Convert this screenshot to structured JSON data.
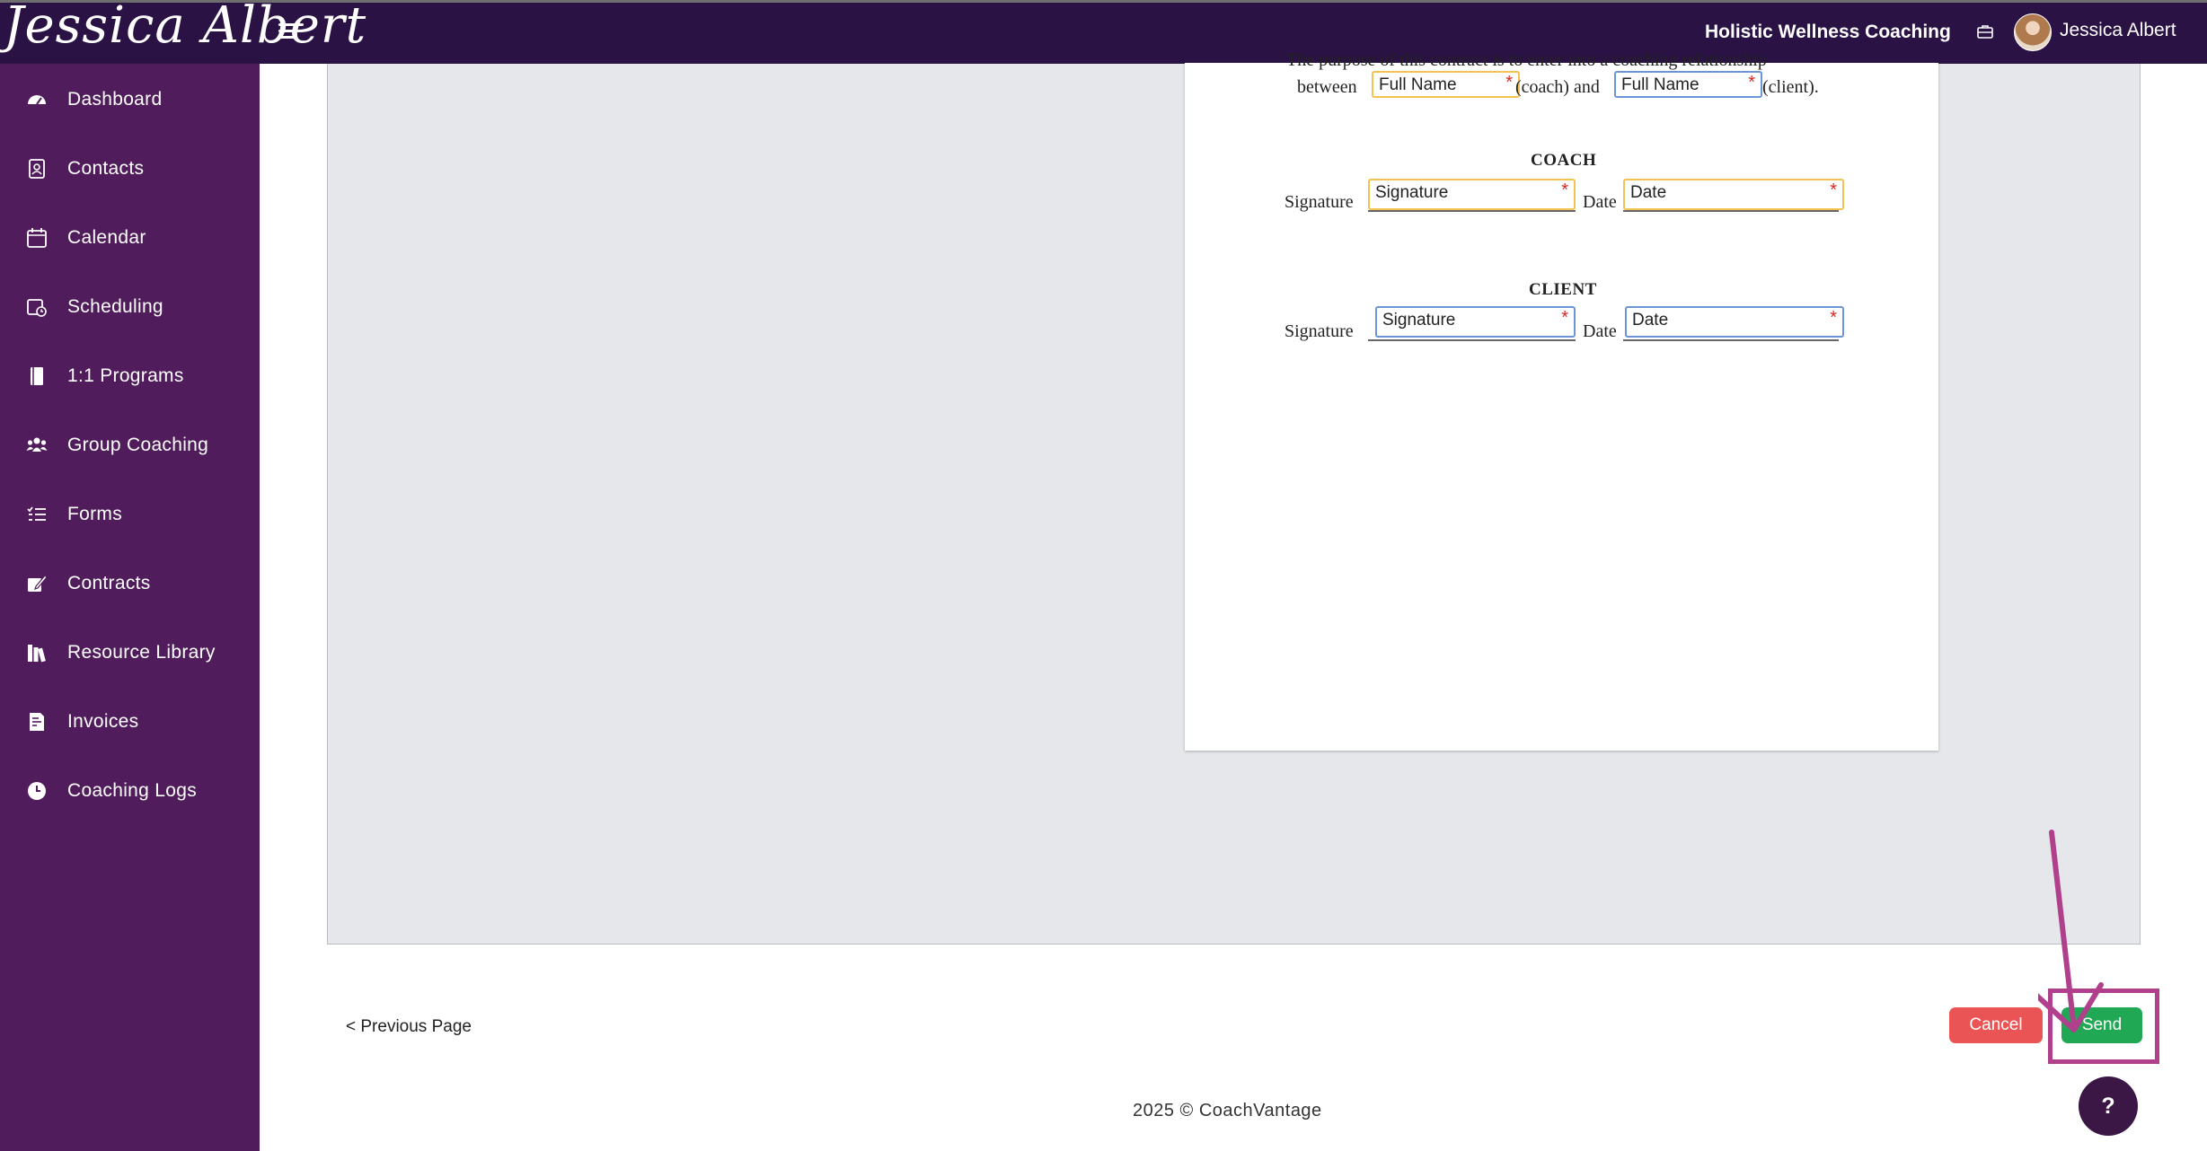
{
  "header": {
    "logo_text": "Jessica Albert",
    "business_name": "Holistic Wellness Coaching",
    "user_name": "Jessica Albert"
  },
  "sidebar": {
    "items": [
      {
        "label": "Dashboard",
        "icon": "dashboard-icon"
      },
      {
        "label": "Contacts",
        "icon": "contacts-icon"
      },
      {
        "label": "Calendar",
        "icon": "calendar-icon"
      },
      {
        "label": "Scheduling",
        "icon": "scheduling-icon"
      },
      {
        "label": "1:1 Programs",
        "icon": "book-icon"
      },
      {
        "label": "Group Coaching",
        "icon": "group-icon"
      },
      {
        "label": "Forms",
        "icon": "checklist-icon"
      },
      {
        "label": "Contracts",
        "icon": "edit-icon"
      },
      {
        "label": "Resource Library",
        "icon": "library-icon"
      },
      {
        "label": "Invoices",
        "icon": "invoice-icon"
      },
      {
        "label": "Coaching Logs",
        "icon": "clock-icon"
      }
    ]
  },
  "document": {
    "cut_text": "The purpose of this contract is to enter into a coaching relationship",
    "between_text": "between",
    "coach_suffix": "(coach) and",
    "client_suffix": "(client).",
    "full_name_placeholder": "Full Name",
    "required_mark": "*",
    "coach_heading": "COACH",
    "client_heading": "CLIENT",
    "signature_label": "Signature",
    "date_label": "Date",
    "signature_field": "Signature",
    "date_field": "Date"
  },
  "actions": {
    "previous_page": "< Previous Page",
    "cancel": "Cancel",
    "send": "Send",
    "help": "?"
  },
  "footer": {
    "text": "2025 © CoachVantage"
  },
  "colors": {
    "topbar": "#2a1244",
    "sidebar": "#501c5c",
    "coach_field_border": "#f4c24f",
    "client_field_border": "#6c95d9",
    "cancel": "#eb5454",
    "send": "#21a854",
    "annotation": "#b03f8c"
  }
}
